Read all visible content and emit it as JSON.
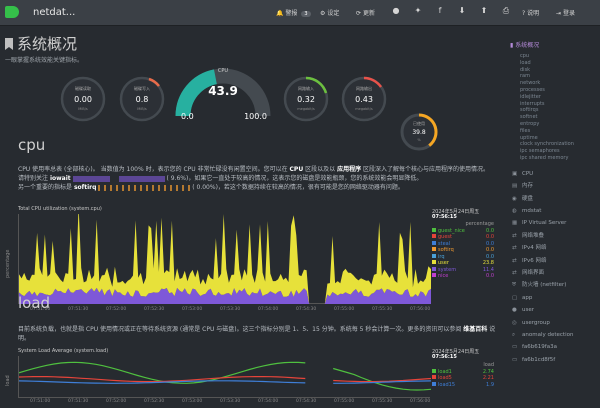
{
  "topbar": {
    "brand": "netdat...",
    "alarms_label": "警报",
    "alarms_count": "3",
    "settings_label": "设定",
    "update_label": "更新",
    "help_label": "说明",
    "signin_label": "登录"
  },
  "page": {
    "title": "系统概况",
    "subtitle": "一眼掌握系统效能关键指标。"
  },
  "gauges": {
    "disk_read": {
      "label": "磁碟读取",
      "value": "0.00",
      "unit": "MiB/s"
    },
    "disk_write": {
      "label": "磁碟写入",
      "value": "0.8",
      "unit": "MiB/s"
    },
    "cpu": {
      "label": "CPU",
      "value": "43.9",
      "min": "0.0",
      "max": "100.0",
      "unit": "%",
      "fill_percent": 43.9
    },
    "net_in": {
      "label": "网路输入",
      "value": "0.32",
      "unit": "megabit/s"
    },
    "net_out": {
      "label": "网路输出",
      "value": "0.43",
      "unit": "megabit/s"
    },
    "ram": {
      "label": "已使用",
      "value": "39.8",
      "unit": "%",
      "fill_percent": 39.8
    }
  },
  "cpu_section": {
    "title": "cpu",
    "para1_a": "CPU 使用率总表 (全部核心)。 当数值为 100% 时，表示您的 CPU 非常忙碌没有闲置空间。您可以在",
    "para1_b": "CPU",
    "para1_c": "区段以及以",
    "para1_d": "应用程序",
    "para1_e": "区段深入了解每个核心与应用程序的使用情况。",
    "para2_a": "请特别关注",
    "para2_b": "iowait",
    "para2_c": "( 9.6%)，如果它一直处于较高的情况，这表示您的磁盘是效能瓶颈，您的系统效能会明显降低。",
    "para3_a": "另一个重要的指标是",
    "para3_b": "softirq",
    "para3_c": "( 0.00%)，若这个数据持续在较高的情况，很有可能是您的网络驱动器有问题。",
    "chart_title": "Total CPU utilization (system.cpu)",
    "date": "2024年5月24日周五",
    "time": "07:56:15",
    "ylabel": "percentage",
    "legend_header": "percentage",
    "legend": [
      {
        "name": "guest_nice",
        "value": "0.0",
        "color": "#4fc03f"
      },
      {
        "name": "guest",
        "value": "0.0",
        "color": "#e6443a"
      },
      {
        "name": "steal",
        "value": "0.0",
        "color": "#3f7fd8"
      },
      {
        "name": "softirq",
        "value": "0.0",
        "color": "#f09a30"
      },
      {
        "name": "irq",
        "value": "0.0",
        "color": "#4aa0d8"
      },
      {
        "name": "user",
        "value": "23.8",
        "color": "#e7e13a"
      },
      {
        "name": "system",
        "value": "11.4",
        "color": "#7e58d8"
      },
      {
        "name": "nice",
        "value": "0.0",
        "color": "#c13fcf"
      }
    ],
    "xticks": [
      "07:51:00",
      "07:51:30",
      "07:52:00",
      "07:52:30",
      "07:53:00",
      "07:53:30",
      "07:54:00",
      "07:54:30",
      "07:55:00",
      "07:55:30",
      "07:56:00"
    ]
  },
  "load_section": {
    "title": "load",
    "para_a": "目前系统负载，也就是指 CPU 使用情况或正在等待系统资源 (通常是 CPU 与磁盘)。这三个指标分别是 1、5、15 分钟。系统每 5 秒会计算一次。更多的资讯可以参阅",
    "para_b": "维基百科",
    "para_c": "说明。",
    "chart_title": "System Load Average (system.load)",
    "date": "2024年5月24日周五",
    "time": "07:56:15",
    "ylabel": "load",
    "legend_header": "load",
    "legend": [
      {
        "name": "load1",
        "value": "2.74",
        "color": "#4fc03f"
      },
      {
        "name": "load5",
        "value": "2.21",
        "color": "#e6443a"
      },
      {
        "name": "load15",
        "value": "1.9",
        "color": "#3f7fd8"
      }
    ],
    "xticks": [
      "07:51:00",
      "07:51:30",
      "07:52:00",
      "07:52:30",
      "07:53:00",
      "07:53:30",
      "07:54:00",
      "07:54:30",
      "07:55:00",
      "07:55:30",
      "07:56:00"
    ]
  },
  "toc": {
    "head": "系统概况",
    "subs": [
      "cpu",
      "load",
      "disk",
      "ram",
      "network",
      "processes",
      "idlejitter",
      "interrupts",
      "softirqs",
      "softnet",
      "entropy",
      "files",
      "uptime",
      "clock synchronization",
      "ipc semaphores",
      "ipc shared memory"
    ],
    "sections": [
      {
        "icon": "cpu-icon",
        "label": "CPU"
      },
      {
        "icon": "memory-icon",
        "label": "内存"
      },
      {
        "icon": "disk-icon",
        "label": "硬盘"
      },
      {
        "icon": "mdstat-icon",
        "label": "mdstat"
      },
      {
        "icon": "server-icon",
        "label": "IP Virtual Server"
      },
      {
        "icon": "network-icon",
        "label": "网络堆叠"
      },
      {
        "icon": "network-icon",
        "label": "IPv4 网络"
      },
      {
        "icon": "network-icon",
        "label": "IPv6 网络"
      },
      {
        "icon": "network-icon",
        "label": "网络界面"
      },
      {
        "icon": "shield-icon",
        "label": "防火墙 (netfilter)"
      },
      {
        "icon": "app-icon",
        "label": "app"
      },
      {
        "icon": "user-icon",
        "label": "user"
      },
      {
        "icon": "group-icon",
        "label": "usergroup"
      },
      {
        "icon": "search-icon",
        "label": "anomaly detection"
      },
      {
        "icon": "container-icon",
        "label": "fa6b619fa3a"
      },
      {
        "icon": "container-icon",
        "label": "fa6b1cd8f5f"
      }
    ]
  }
}
